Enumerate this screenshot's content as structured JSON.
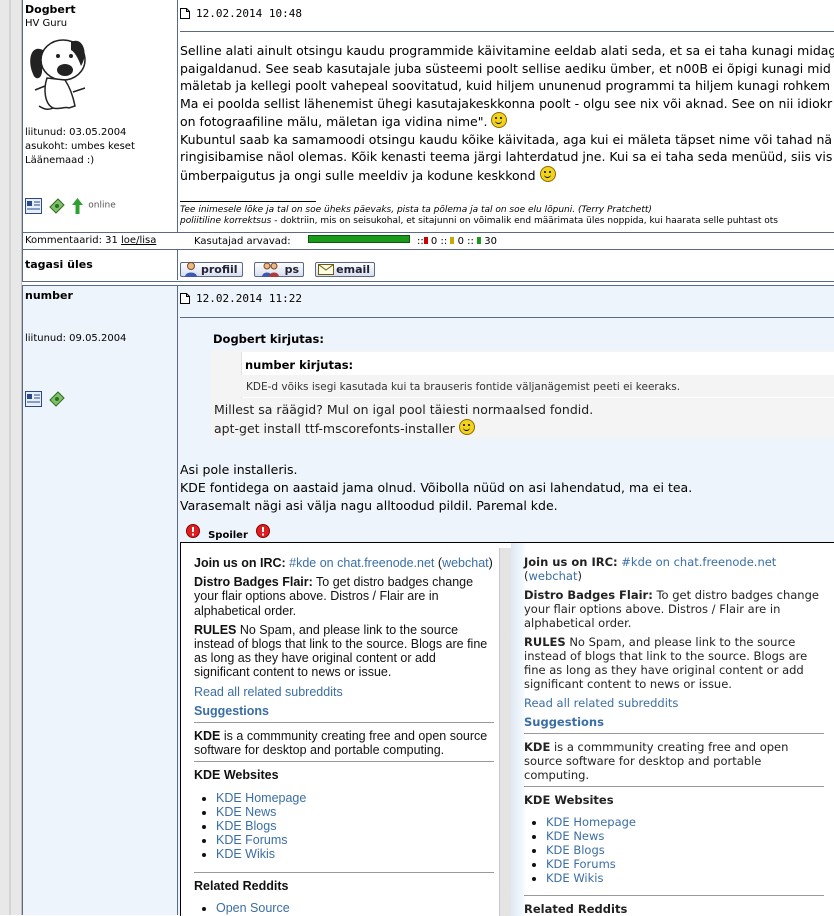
{
  "post1": {
    "username": "Dogbert",
    "rank": "HV Guru",
    "joined": "liitunud: 03.05.2004",
    "location": "asukoht: umbes keset",
    "location2": "Läänemaad :)",
    "online": "online",
    "date": "12.02.2014 10:48",
    "lines": [
      "Selline alati ainult otsingu kaudu programmide käivitamine eeldab alati seda, et sa ei taha kunagi midag",
      "paigaldanud. See seab kasutajale juba süsteemi poolt sellise aediku ümber, et n00B ei õpigi kunagi mid",
      "mäletab ja kellegi poolt vahepeal soovitatud, kuid hiljem ununenud programmi ta hiljem kunagi rohkem",
      "Ma ei poolda sellist lähenemist ühegi kasutajakeskkonna poolt - olgu see nix või aknad. See on nii idiokr",
      "on fotograafiline mälu, mäletan iga vidina nime\".",
      "Kubuntul saab ka samamoodi otsingu kaudu kõike käivitada, aga kui ei mäleta täpset nime või tahad nä",
      "ringisibamise näol olemas. Kõik kenasti teema järgi lahterdatud jne. Kui sa ei taha seda menüüd, siis vis",
      "ümberpaigutus ja ongi sulle meeldiv ja kodune keskkond"
    ],
    "sig1": "Tee inimesele lõke ja tal on soe üheks päevaks, pista ta põlema ja tal on soe elu lõpuni. (Terry Pratchett)",
    "sig2_term": "poliitiline korrektsus",
    "sig2_rest": " - doktriin, mis on seisukohal, et sitajunni on võimalik end määrimata üles noppida, kui haarata selle puhtast ots"
  },
  "stats": {
    "comments": "Kommentaarid: 31",
    "loe": "loe/lisa",
    "users_rate": "Kasutajad arvavad:",
    "red": "0",
    "yellow": "0",
    "green": "30",
    "sep": "::"
  },
  "backtop": "tagasi üles",
  "buttons": {
    "profile": "profiil",
    "pm": "ps",
    "email": "email"
  },
  "post2": {
    "username": "number",
    "joined": "liitunud: 09.05.2004",
    "date": "12.02.2014 11:22",
    "quote_outer_author": "Dogbert kirjutas:",
    "quote_inner_author": "number kirjutas:",
    "quote_inner_text": "KDE-d võiks isegi kasutada kui ta brauseris fontide väljanägemist peeti ei keeraks.",
    "quote_outer_l1": "Millest sa räägid? Mul on igal pool täiesti normaalsed fondid.",
    "quote_outer_l2": "apt-get install ttf-mscorefonts-installer",
    "body": [
      "Asi pole installeris.",
      "KDE fontidega on aastaid jama olnud. Võibolla nüüd on asi lahendatud, ma ei tea.",
      "Varasemalt nägi asi välja nagu alltoodud pildil. Paremal kde."
    ],
    "spoiler": "Spoiler"
  },
  "panel": {
    "irc_label": "Join us on IRC:",
    "irc_chan": "#kde on chat.freenode.net",
    "webchat": "webchat",
    "flair_label": "Distro Badges Flair:",
    "flair_text": "To get distro badges change your flair options above. Distros / Flair are in alphabetical order.",
    "rules_label": "RULES",
    "rules_text": "No Spam, and please link to the source instead of blogs that link to the source. Blogs are fine as long as they have original content or add significant content to news or issue.",
    "read_all": "Read all related subreddits",
    "suggestions": "Suggestions",
    "kde_label": "KDE",
    "kde_text": "is a commmunity creating free and open source software for desktop and portable computing.",
    "websites": "KDE Websites",
    "links": [
      "KDE Homepage",
      "KDE News",
      "KDE Blogs",
      "KDE Forums",
      "KDE Wikis"
    ],
    "related": "Related Reddits",
    "related_first": "Open Source"
  },
  "colors": {
    "frame": "#5a6a8a",
    "link": "#3a6ea5",
    "post2_bg": "#eef4fb"
  }
}
